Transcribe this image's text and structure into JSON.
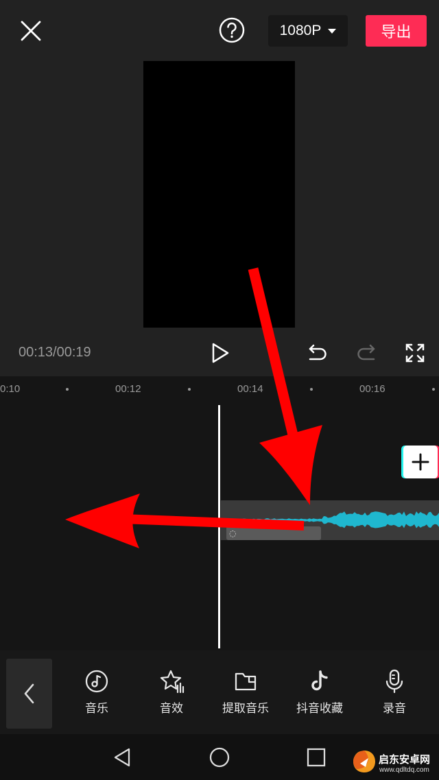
{
  "topbar": {
    "resolution": "1080P",
    "export_label": "导出"
  },
  "player": {
    "timecode": "00:13/00:19"
  },
  "timeline": {
    "ruler_labels": [
      "0:10",
      "00:12",
      "00:14",
      "00:16"
    ]
  },
  "toolbar": {
    "items": [
      {
        "label": "音乐",
        "icon": "music-disc-icon"
      },
      {
        "label": "音效",
        "icon": "sound-effect-star-icon"
      },
      {
        "label": "提取音乐",
        "icon": "folder-icon"
      },
      {
        "label": "抖音收藏",
        "icon": "tiktok-icon"
      },
      {
        "label": "录音",
        "icon": "microphone-icon"
      }
    ]
  },
  "watermark": {
    "title": "启东安卓网",
    "url": "www.qdltdq.com"
  },
  "colors": {
    "accent": "#fe2c55",
    "waveform": "#1fb7cf",
    "annotation_arrow": "#ff0000"
  }
}
